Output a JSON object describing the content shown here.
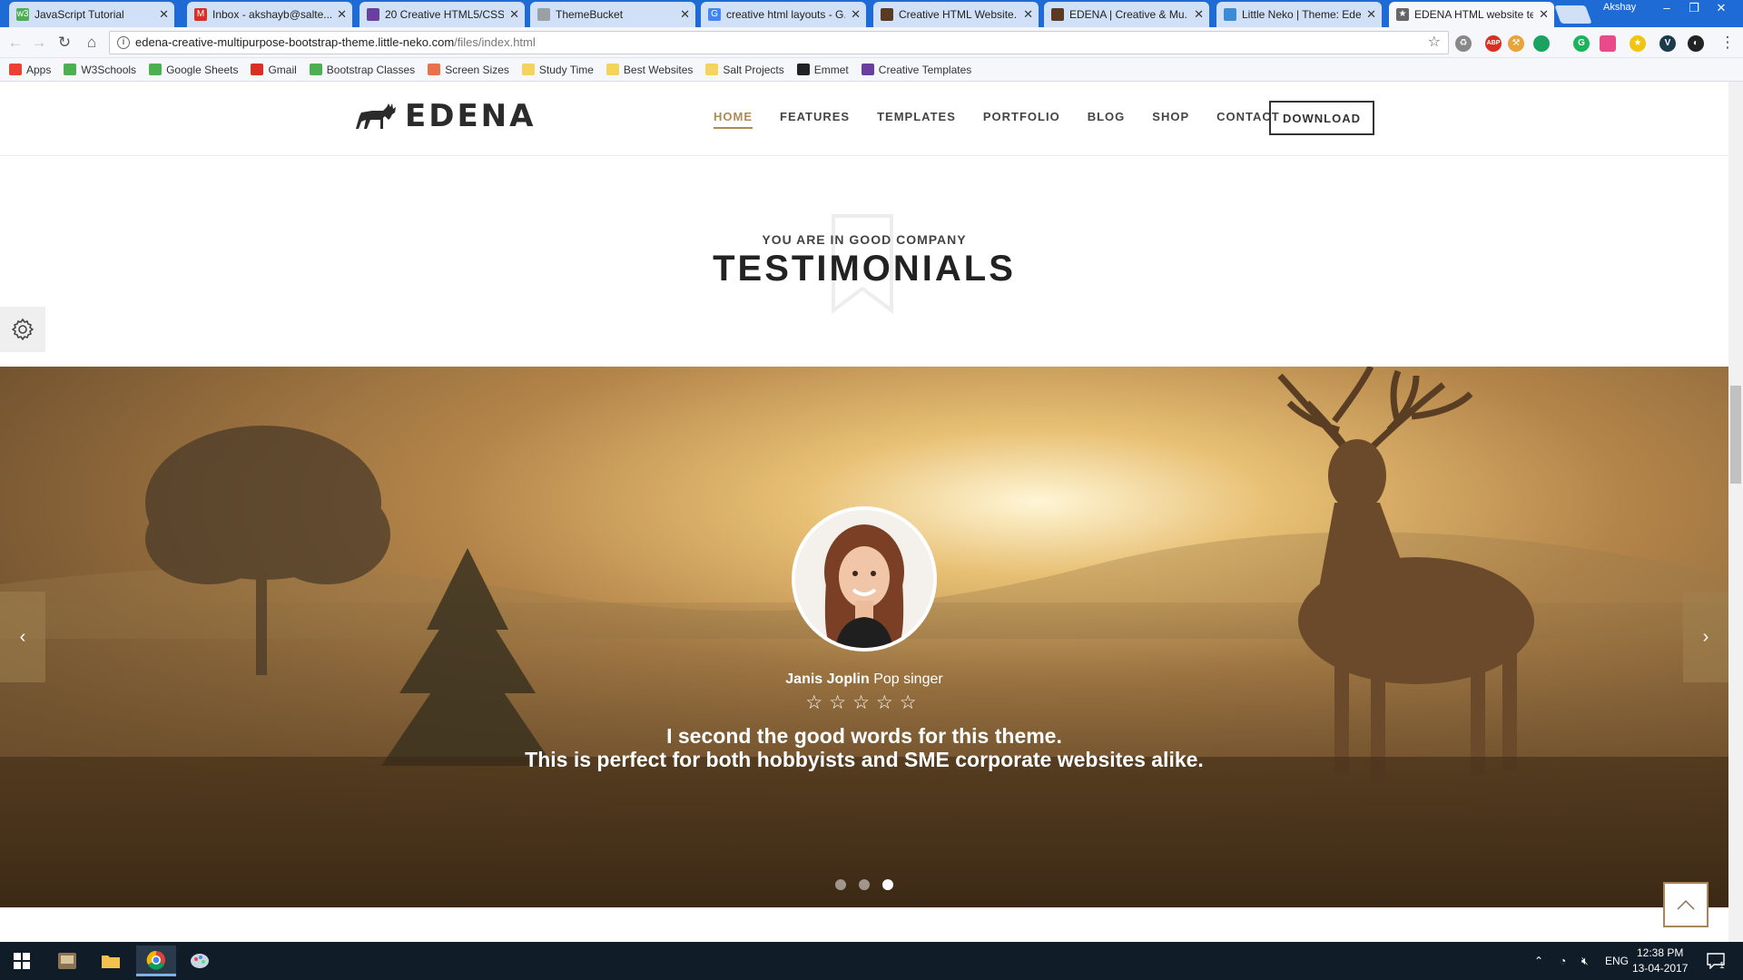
{
  "browser": {
    "tabs": [
      {
        "title": "JavaScript Tutorial",
        "fav_color": "#4caf50",
        "fav": "w3"
      },
      {
        "title": "Inbox - akshayb@salte...",
        "fav_color": "#d93025",
        "fav": "M"
      },
      {
        "title": "20 Creative HTML5/CSS...",
        "fav_color": "#6a3fa0",
        "fav": ""
      },
      {
        "title": "ThemeBucket",
        "fav_color": "#9aa0a6",
        "fav": ""
      },
      {
        "title": "creative html layouts - G...",
        "fav_color": "#4285f4",
        "fav": "G"
      },
      {
        "title": "Creative HTML Website...",
        "fav_color": "#5a3b22",
        "fav": ""
      },
      {
        "title": "EDENA | Creative & Mu...",
        "fav_color": "#5a3b22",
        "fav": ""
      },
      {
        "title": "Little Neko | Theme: Ede...",
        "fav_color": "#3b8bd6",
        "fav": ""
      },
      {
        "title": "EDENA HTML website te...",
        "fav_color": "#666666",
        "fav": "★"
      }
    ],
    "profile_name": "Akshay",
    "url_host": "edena-creative-multipurpose-bootstrap-theme.little-neko.com",
    "url_path": "/files/index.html",
    "bookmarks": [
      {
        "label": "Apps",
        "color": "#e94235"
      },
      {
        "label": "W3Schools",
        "color": "#4caf50"
      },
      {
        "label": "Google Sheets",
        "color": "#4caf50"
      },
      {
        "label": "Gmail",
        "color": "#d93025"
      },
      {
        "label": "Bootstrap Classes",
        "color": "#4caf50"
      },
      {
        "label": "Screen Sizes",
        "color": "#e8734a"
      },
      {
        "label": "Study Time",
        "color": "#f4d35e"
      },
      {
        "label": "Best Websites",
        "color": "#f4d35e"
      },
      {
        "label": "Salt Projects",
        "color": "#f4d35e"
      },
      {
        "label": "Emmet",
        "color": "#222222"
      },
      {
        "label": "Creative Templates",
        "color": "#6a3fa0"
      }
    ]
  },
  "site": {
    "brand": "EDENA",
    "menu": [
      "HOME",
      "FEATURES",
      "TEMPLATES",
      "PORTFOLIO",
      "BLOG",
      "SHOP",
      "CONTACT"
    ],
    "active_menu": "HOME",
    "download_label": "DOWNLOAD",
    "accent": "#b08a56"
  },
  "testimonials": {
    "eyebrow": "YOU ARE IN GOOD COMPANY",
    "title": "TESTIMONIALS",
    "name": "Janis Joplin",
    "role": "Pop singer",
    "stars": "☆☆☆☆☆",
    "quote_line1": "I second the good words for this theme.",
    "quote_line2": "This is perfect for both hobbyists and SME corporate websites alike.",
    "prev_label": "‹",
    "next_label": "›",
    "active_slide": 3,
    "slide_count": 3
  },
  "taskbar": {
    "lang": "ENG",
    "time": "12:38 PM",
    "date": "13-04-2017",
    "notifications": "1"
  }
}
